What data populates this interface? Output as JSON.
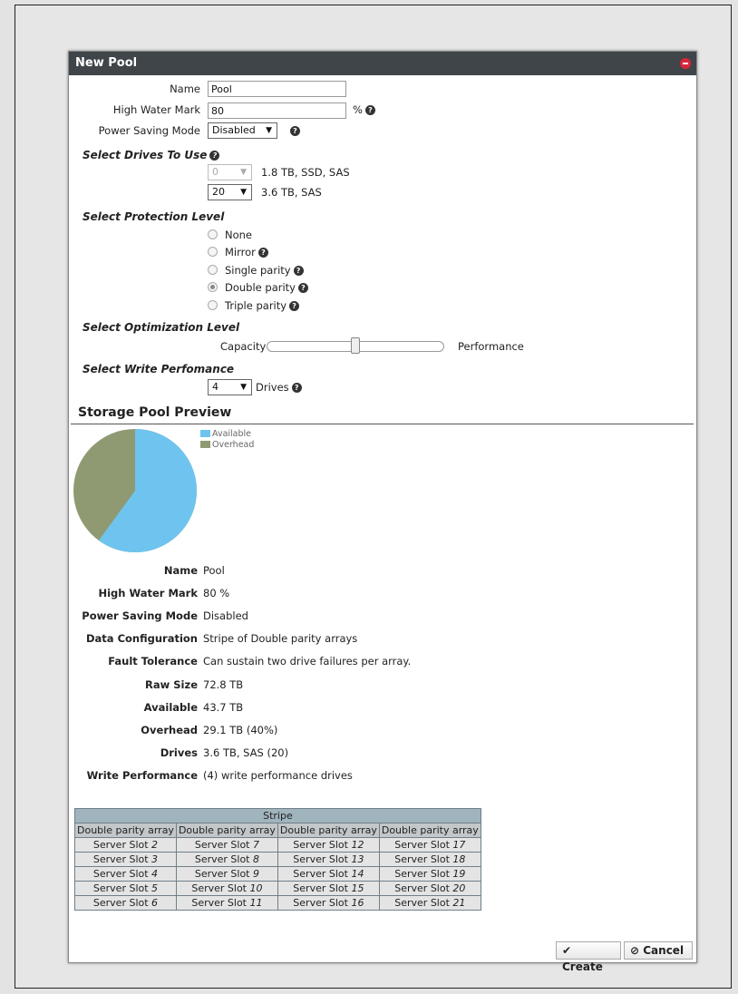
{
  "dialog": {
    "title": "New Pool"
  },
  "form": {
    "name_label": "Name",
    "name_value": "Pool",
    "hwm_label": "High Water Mark",
    "hwm_value": "80",
    "hwm_unit": "%",
    "psm_label": "Power Saving Mode",
    "psm_value": "Disabled",
    "drives_section": "Select Drives To Use",
    "drive_rows": [
      {
        "count": "0",
        "desc": "1.8 TB, SSD, SAS",
        "disabled": true
      },
      {
        "count": "20",
        "desc": "3.6 TB, SAS",
        "disabled": false
      }
    ],
    "protection_section": "Select Protection Level",
    "protection_options": [
      "None",
      "Mirror",
      "Single parity",
      "Double parity",
      "Triple parity"
    ],
    "protection_selected": "Double parity",
    "optimization_section": "Select Optimization Level",
    "opt_left": "Capacity",
    "opt_right": "Performance",
    "opt_value": 0.5,
    "write_section": "Select Write Perfomance",
    "write_value": "4",
    "write_unit": "Drives"
  },
  "preview": {
    "title": "Storage Pool Preview",
    "legend": [
      {
        "label": "Available",
        "color": "#6ec4ef"
      },
      {
        "label": "Overhead",
        "color": "#8f9a73"
      }
    ],
    "pie": {
      "available": 43.7,
      "overhead": 29.1
    },
    "details": [
      {
        "label": "Name",
        "value": "Pool"
      },
      {
        "label": "High Water Mark",
        "value": "80 %"
      },
      {
        "label": "Power Saving Mode",
        "value": "Disabled"
      },
      {
        "label": "Data Configuration",
        "value": "Stripe of Double parity arrays"
      },
      {
        "label": "Fault Tolerance",
        "value": "Can sustain two drive failures per array."
      },
      {
        "label": "Raw Size",
        "value": "72.8 TB"
      },
      {
        "label": "Available",
        "value": "43.7 TB"
      },
      {
        "label": "Overhead",
        "value": "29.1 TB (40%)"
      },
      {
        "label": "Drives",
        "value": "3.6 TB, SAS (20)"
      },
      {
        "label": "Write Performance",
        "value": "(4) write performance drives"
      }
    ],
    "table": {
      "header": "Stripe",
      "columns": [
        "Double parity array",
        "Double parity array",
        "Double parity array",
        "Double parity array"
      ],
      "slot_label": "Server Slot",
      "rows": [
        [
          "2",
          "7",
          "12",
          "17"
        ],
        [
          "3",
          "8",
          "13",
          "18"
        ],
        [
          "4",
          "9",
          "14",
          "19"
        ],
        [
          "5",
          "10",
          "15",
          "20"
        ],
        [
          "6",
          "11",
          "16",
          "21"
        ]
      ]
    }
  },
  "buttons": {
    "create": "Create",
    "cancel": "Cancel"
  }
}
